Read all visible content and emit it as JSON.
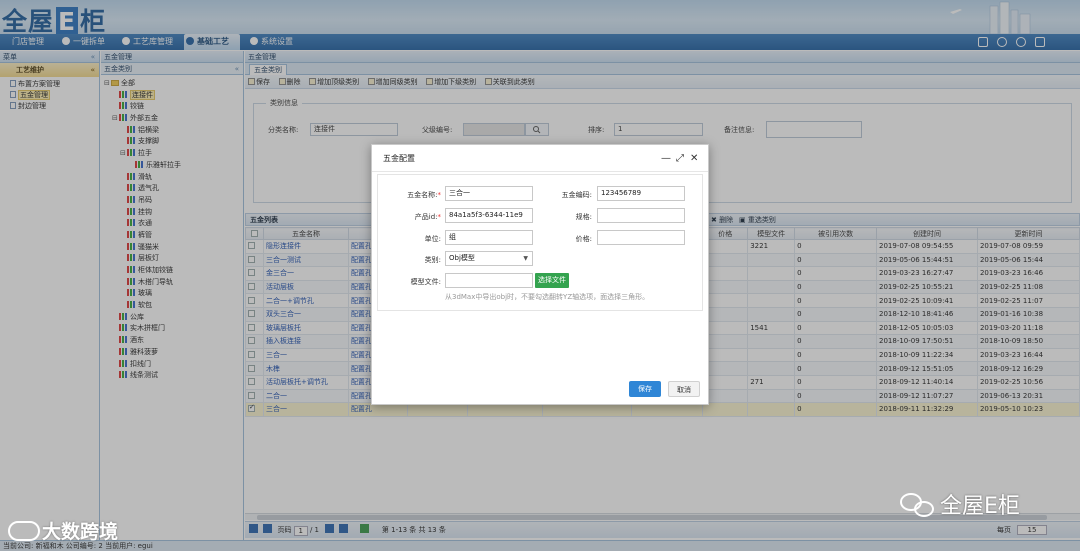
{
  "app": {
    "logo_text_a": "全屋",
    "logo_text_e": "E",
    "logo_text_b": "柜"
  },
  "nav": {
    "items": [
      {
        "label": "门店管理"
      },
      {
        "label": "一键拆单"
      },
      {
        "label": "工艺库管理"
      },
      {
        "label": "基础工艺"
      },
      {
        "label": "系统设置"
      }
    ],
    "active": "基础工艺"
  },
  "left_panel": {
    "header": "菜单",
    "collapse": "«",
    "section": "工艺维护",
    "section_toggle": "«",
    "items": [
      {
        "label": "布置方案管理"
      },
      {
        "label": "五金管理"
      },
      {
        "label": "封边管理"
      }
    ]
  },
  "tree_panel": {
    "header": "五金管理",
    "sub_header": "五金类别",
    "collapse": "«",
    "nodes": [
      {
        "label": "全部",
        "level": 0,
        "toggle": "⊟",
        "type": "folder"
      },
      {
        "label": "连接件",
        "level": 1,
        "type": "leaf",
        "selected": true
      },
      {
        "label": "铰链",
        "level": 1,
        "type": "leaf"
      },
      {
        "label": "外部五金",
        "level": 1,
        "toggle": "⊟",
        "type": "leaf"
      },
      {
        "label": "铝横梁",
        "level": 2,
        "type": "leaf"
      },
      {
        "label": "支撑脚",
        "level": 2,
        "type": "leaf"
      },
      {
        "label": "拉手",
        "level": 2,
        "toggle": "⊟",
        "type": "leaf"
      },
      {
        "label": "乐雅轩拉手",
        "level": 3,
        "type": "leaf"
      },
      {
        "label": "滑轨",
        "level": 2,
        "type": "leaf"
      },
      {
        "label": "透气孔",
        "level": 2,
        "type": "leaf"
      },
      {
        "label": "吊码",
        "level": 2,
        "type": "leaf"
      },
      {
        "label": "挂钩",
        "level": 2,
        "type": "leaf"
      },
      {
        "label": "衣通",
        "level": 2,
        "type": "leaf"
      },
      {
        "label": "裤管",
        "level": 2,
        "type": "leaf"
      },
      {
        "label": "骚猫米",
        "level": 2,
        "type": "leaf"
      },
      {
        "label": "层板灯",
        "level": 2,
        "type": "leaf"
      },
      {
        "label": "柜体加铰链",
        "level": 2,
        "type": "leaf"
      },
      {
        "label": "木搭门导轨",
        "level": 2,
        "type": "leaf"
      },
      {
        "label": "玻璃",
        "level": 2,
        "type": "leaf"
      },
      {
        "label": "软包",
        "level": 2,
        "type": "leaf"
      },
      {
        "label": "公库",
        "level": 1,
        "type": "leaf"
      },
      {
        "label": "实木拼框门",
        "level": 1,
        "type": "leaf"
      },
      {
        "label": "酒东",
        "level": 1,
        "type": "leaf"
      },
      {
        "label": "雅科菠萝",
        "level": 1,
        "type": "leaf"
      },
      {
        "label": "扣线门",
        "level": 1,
        "type": "leaf"
      },
      {
        "label": "线条测试",
        "level": 1,
        "type": "leaf"
      }
    ]
  },
  "main": {
    "tab": "五金类别",
    "toolbar": [
      {
        "label": "保存"
      },
      {
        "label": "删除"
      },
      {
        "label": "增加顶级类别"
      },
      {
        "label": "增加同级类别"
      },
      {
        "label": "增加下级类别"
      },
      {
        "label": "关联到此类别"
      }
    ],
    "category_info": {
      "legend": "类别信息",
      "name_label": "分类名称:",
      "name_value": "连接件",
      "parent_label": "父级编号:",
      "parent_value": "",
      "sort_label": "排序:",
      "sort_value": "1",
      "remark_label": "备注信息:",
      "remark_value": ""
    },
    "list": {
      "title": "五金列表",
      "delete_label": "删除",
      "reselect_label": "重选类别",
      "columns": [
        "",
        "五金名称",
        "",
        "",
        "",
        "",
        "",
        "价格",
        "模型文件",
        "被引用次数",
        "创建时间",
        "更新时间"
      ],
      "rows": [
        {
          "name": "隐形连接件",
          "cfg": "配置孔",
          "model": "3221",
          "refs": "0",
          "created": "2019-07-08 09:54:55",
          "updated": "2019-07-08 09:59",
          "checked": false
        },
        {
          "name": "三合一测试",
          "cfg": "配置孔",
          "model": "",
          "refs": "0",
          "created": "2019-05-06 15:44:51",
          "updated": "2019-05-06 15:44",
          "checked": false
        },
        {
          "name": "金三合一",
          "cfg": "配置孔",
          "model": "",
          "refs": "0",
          "created": "2019-03-23 16:27:47",
          "updated": "2019-03-23 16:46",
          "checked": false
        },
        {
          "name": "活动层板",
          "cfg": "配置孔",
          "model": "",
          "refs": "0",
          "created": "2019-02-25 10:55:21",
          "updated": "2019-02-25 11:08",
          "checked": false
        },
        {
          "name": "二合一+调节孔",
          "cfg": "配置孔",
          "model": "",
          "refs": "0",
          "created": "2019-02-25 10:09:41",
          "updated": "2019-02-25 11:07",
          "checked": false
        },
        {
          "name": "双头三合一",
          "cfg": "配置孔",
          "model": "",
          "refs": "0",
          "created": "2018-12-10 18:41:46",
          "updated": "2019-01-16 10:38",
          "checked": false
        },
        {
          "name": "玻璃层板托",
          "cfg": "配置孔",
          "model": "1541",
          "refs": "0",
          "created": "2018-12-05 10:05:03",
          "updated": "2019-03-20 11:18",
          "checked": false
        },
        {
          "name": "插入板连接",
          "cfg": "配置孔",
          "model": "",
          "refs": "0",
          "created": "2018-10-09 17:50:51",
          "updated": "2018-10-09 18:50",
          "checked": false
        },
        {
          "name": "三合一",
          "cfg": "配置孔",
          "model": "",
          "refs": "0",
          "created": "2018-10-09 11:22:34",
          "updated": "2019-03-23 16:44",
          "checked": false
        },
        {
          "name": "木榫",
          "cfg": "配置孔",
          "model": "",
          "refs": "0",
          "created": "2018-09-12 15:51:05",
          "updated": "2018-09-12 16:29",
          "checked": false
        },
        {
          "name": "活动层板托+调节孔",
          "cfg": "配置孔",
          "model": "271",
          "refs": "0",
          "created": "2018-09-12 11:40:14",
          "updated": "2019-02-25 10:56",
          "checked": false
        },
        {
          "name": "二合一",
          "cfg": "配置孔",
          "model": "",
          "refs": "0",
          "created": "2018-09-12 11:07:27",
          "updated": "2019-06-13 20:31",
          "checked": false
        },
        {
          "name": "三合一",
          "cfg": "配置孔",
          "model": "",
          "refs": "0",
          "created": "2018-09-11 11:32:29",
          "updated": "2019-05-10 10:23",
          "checked": true
        }
      ]
    },
    "pager": {
      "page_label": "页码",
      "page_value": "1",
      "of_label": "/ 1",
      "summary": "第 1-13 条  共 13 条",
      "per_page_label": "每页",
      "per_page_value": "15"
    }
  },
  "status_bar": "当前公司: 新福和木  公司编号: 2  当前用户: egui",
  "modal": {
    "title": "五金配置",
    "min": "—",
    "max": "⤢",
    "close": "✕",
    "fields": {
      "name_label": "五金名称:",
      "name_value": "三合一",
      "code_label": "五金编码:",
      "code_value": "123456789",
      "pid_label": "产品id:",
      "pid_value": "84a1a5f3-6344-11e9",
      "spec_label": "规格:",
      "spec_value": "",
      "unit_label": "单位:",
      "unit_value": "组",
      "price_label": "价格:",
      "price_value": "",
      "type_label": "类别:",
      "type_value": "Obj模型",
      "model_label": "模型文件:",
      "model_value": "",
      "choose_label": "选择文件",
      "hint": "从3dMax中导出obj时，不要勾选翻转YZ轴选项，面选择三角形。"
    },
    "save_label": "保存",
    "cancel_label": "取消"
  },
  "watermarks": {
    "left": "大数跨境",
    "right": "全屋E柜"
  },
  "colors": {
    "nav_bg": "#2262a4",
    "accent_green": "#34a34f",
    "save_blue": "#2f86d6",
    "required_red": "#e33333"
  }
}
